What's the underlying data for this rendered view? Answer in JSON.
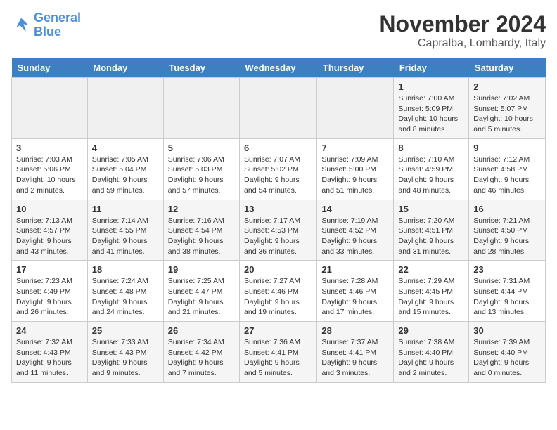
{
  "header": {
    "logo_line1": "General",
    "logo_line2": "Blue",
    "month_title": "November 2024",
    "location": "Capralba, Lombardy, Italy"
  },
  "days_of_week": [
    "Sunday",
    "Monday",
    "Tuesday",
    "Wednesday",
    "Thursday",
    "Friday",
    "Saturday"
  ],
  "weeks": [
    [
      {
        "day": "",
        "info": ""
      },
      {
        "day": "",
        "info": ""
      },
      {
        "day": "",
        "info": ""
      },
      {
        "day": "",
        "info": ""
      },
      {
        "day": "",
        "info": ""
      },
      {
        "day": "1",
        "info": "Sunrise: 7:00 AM\nSunset: 5:09 PM\nDaylight: 10 hours and 8 minutes."
      },
      {
        "day": "2",
        "info": "Sunrise: 7:02 AM\nSunset: 5:07 PM\nDaylight: 10 hours and 5 minutes."
      }
    ],
    [
      {
        "day": "3",
        "info": "Sunrise: 7:03 AM\nSunset: 5:06 PM\nDaylight: 10 hours and 2 minutes."
      },
      {
        "day": "4",
        "info": "Sunrise: 7:05 AM\nSunset: 5:04 PM\nDaylight: 9 hours and 59 minutes."
      },
      {
        "day": "5",
        "info": "Sunrise: 7:06 AM\nSunset: 5:03 PM\nDaylight: 9 hours and 57 minutes."
      },
      {
        "day": "6",
        "info": "Sunrise: 7:07 AM\nSunset: 5:02 PM\nDaylight: 9 hours and 54 minutes."
      },
      {
        "day": "7",
        "info": "Sunrise: 7:09 AM\nSunset: 5:00 PM\nDaylight: 9 hours and 51 minutes."
      },
      {
        "day": "8",
        "info": "Sunrise: 7:10 AM\nSunset: 4:59 PM\nDaylight: 9 hours and 48 minutes."
      },
      {
        "day": "9",
        "info": "Sunrise: 7:12 AM\nSunset: 4:58 PM\nDaylight: 9 hours and 46 minutes."
      }
    ],
    [
      {
        "day": "10",
        "info": "Sunrise: 7:13 AM\nSunset: 4:57 PM\nDaylight: 9 hours and 43 minutes."
      },
      {
        "day": "11",
        "info": "Sunrise: 7:14 AM\nSunset: 4:55 PM\nDaylight: 9 hours and 41 minutes."
      },
      {
        "day": "12",
        "info": "Sunrise: 7:16 AM\nSunset: 4:54 PM\nDaylight: 9 hours and 38 minutes."
      },
      {
        "day": "13",
        "info": "Sunrise: 7:17 AM\nSunset: 4:53 PM\nDaylight: 9 hours and 36 minutes."
      },
      {
        "day": "14",
        "info": "Sunrise: 7:19 AM\nSunset: 4:52 PM\nDaylight: 9 hours and 33 minutes."
      },
      {
        "day": "15",
        "info": "Sunrise: 7:20 AM\nSunset: 4:51 PM\nDaylight: 9 hours and 31 minutes."
      },
      {
        "day": "16",
        "info": "Sunrise: 7:21 AM\nSunset: 4:50 PM\nDaylight: 9 hours and 28 minutes."
      }
    ],
    [
      {
        "day": "17",
        "info": "Sunrise: 7:23 AM\nSunset: 4:49 PM\nDaylight: 9 hours and 26 minutes."
      },
      {
        "day": "18",
        "info": "Sunrise: 7:24 AM\nSunset: 4:48 PM\nDaylight: 9 hours and 24 minutes."
      },
      {
        "day": "19",
        "info": "Sunrise: 7:25 AM\nSunset: 4:47 PM\nDaylight: 9 hours and 21 minutes."
      },
      {
        "day": "20",
        "info": "Sunrise: 7:27 AM\nSunset: 4:46 PM\nDaylight: 9 hours and 19 minutes."
      },
      {
        "day": "21",
        "info": "Sunrise: 7:28 AM\nSunset: 4:46 PM\nDaylight: 9 hours and 17 minutes."
      },
      {
        "day": "22",
        "info": "Sunrise: 7:29 AM\nSunset: 4:45 PM\nDaylight: 9 hours and 15 minutes."
      },
      {
        "day": "23",
        "info": "Sunrise: 7:31 AM\nSunset: 4:44 PM\nDaylight: 9 hours and 13 minutes."
      }
    ],
    [
      {
        "day": "24",
        "info": "Sunrise: 7:32 AM\nSunset: 4:43 PM\nDaylight: 9 hours and 11 minutes."
      },
      {
        "day": "25",
        "info": "Sunrise: 7:33 AM\nSunset: 4:43 PM\nDaylight: 9 hours and 9 minutes."
      },
      {
        "day": "26",
        "info": "Sunrise: 7:34 AM\nSunset: 4:42 PM\nDaylight: 9 hours and 7 minutes."
      },
      {
        "day": "27",
        "info": "Sunrise: 7:36 AM\nSunset: 4:41 PM\nDaylight: 9 hours and 5 minutes."
      },
      {
        "day": "28",
        "info": "Sunrise: 7:37 AM\nSunset: 4:41 PM\nDaylight: 9 hours and 3 minutes."
      },
      {
        "day": "29",
        "info": "Sunrise: 7:38 AM\nSunset: 4:40 PM\nDaylight: 9 hours and 2 minutes."
      },
      {
        "day": "30",
        "info": "Sunrise: 7:39 AM\nSunset: 4:40 PM\nDaylight: 9 hours and 0 minutes."
      }
    ]
  ]
}
